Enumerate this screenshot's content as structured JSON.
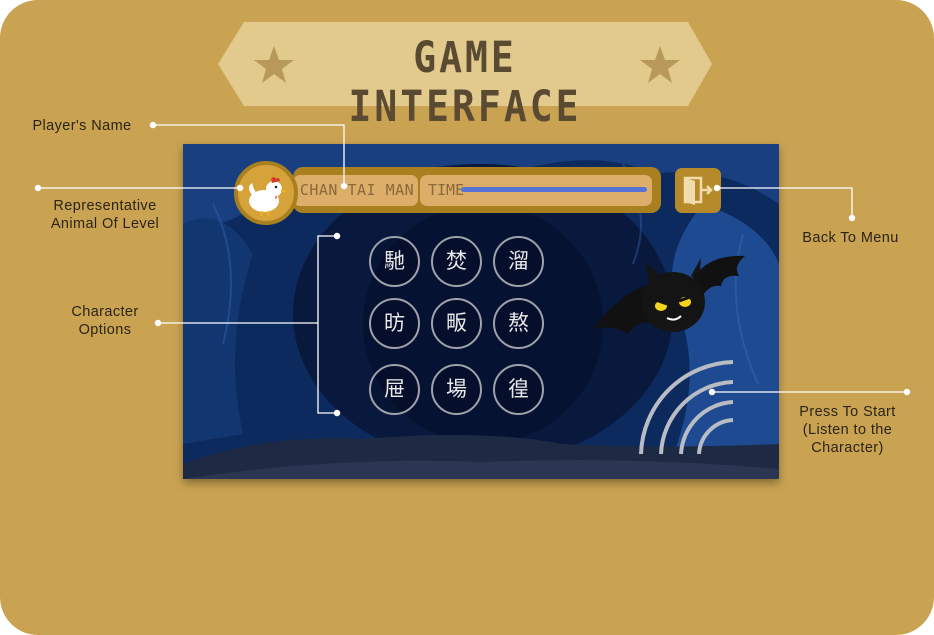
{
  "banner": {
    "title": "GAME INTERFACE",
    "star_icon": "star-icon"
  },
  "callouts": {
    "player_name": "Player's Name",
    "animal_line1": "Representative",
    "animal_line2": "Animal Of Level",
    "char_options_line1": "Character",
    "char_options_line2": "Options",
    "back_to_menu": "Back To Menu",
    "press_start_line1": "Press To Start",
    "press_start_line2": "(Listen to the",
    "press_start_line3": "Character)"
  },
  "game": {
    "player_name": "CHAN TAI MAN",
    "time_label": "TIME",
    "time_progress": 1.0,
    "animal_icon": "chicken-icon",
    "exit_icon": "exit-door-icon",
    "mascot_icon": "bat-icon",
    "sound_icon": "sound-wave-icon",
    "characters": [
      "馳",
      "焚",
      "溜",
      "昉",
      "畈",
      "熬",
      "屉",
      "場",
      "徨"
    ]
  },
  "colors": {
    "board": "#c9a352",
    "banner": "#e2c98c",
    "cave": "#0d2a5e",
    "bar": "#a8801f",
    "time_fill": "#5672d6"
  }
}
